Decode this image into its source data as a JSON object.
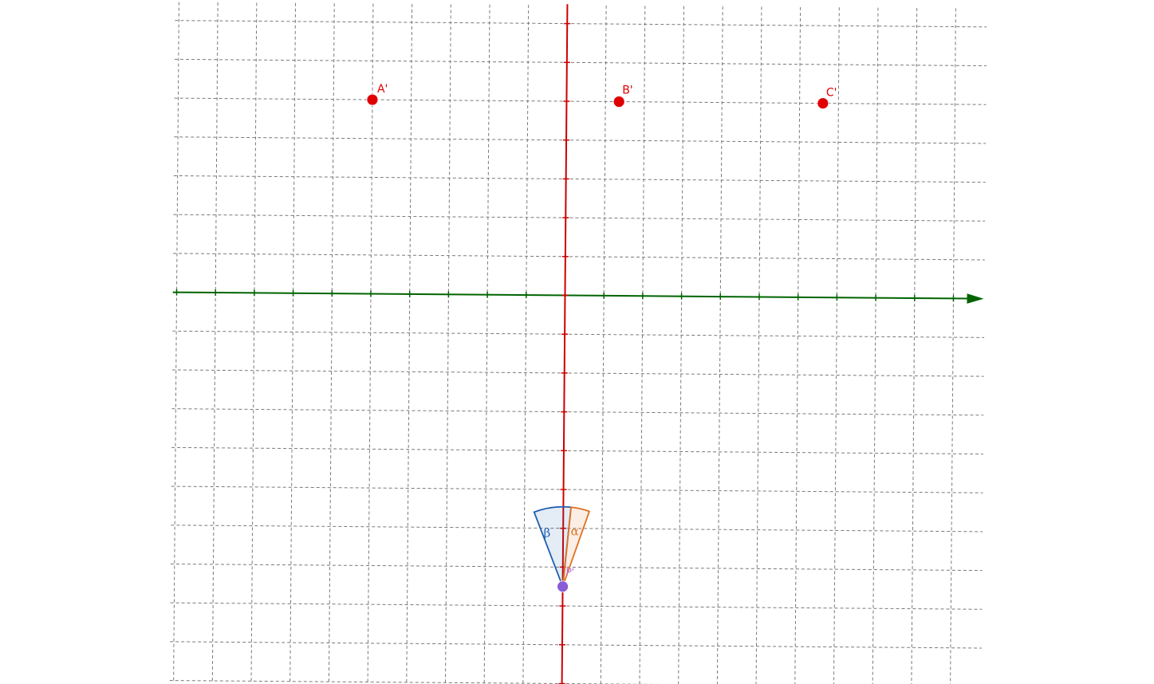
{
  "points": [
    {
      "label": "A'",
      "x": -5,
      "y": 5
    },
    {
      "label": "B'",
      "x": 1.35,
      "y": 5
    },
    {
      "label": "C'",
      "x": 6.6,
      "y": 5
    }
  ],
  "pivot": {
    "label": "P'",
    "x": 0,
    "y": -7.5
  },
  "angles": {
    "alpha": {
      "label": "α",
      "color": "#e07020"
    },
    "beta": {
      "label": "β",
      "color": "#1f5fb0"
    }
  },
  "colors": {
    "x_axis": "#006400",
    "y_axis": "#cc0000",
    "grid": "#7a7a7a",
    "point": "#e00000",
    "pivot": "#8a5cd6"
  },
  "grid": {
    "x_range": [
      -10,
      10
    ],
    "y_range": [
      -10,
      7.5
    ],
    "step": 1
  }
}
